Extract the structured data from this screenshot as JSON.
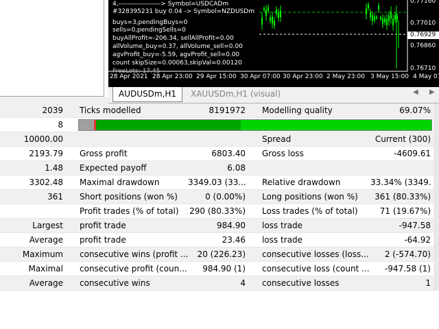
{
  "chart": {
    "overlay_lines": [
      "4,-------------------> Symbol=USDCADm",
      "#328395231 buy 0.04 -> Symbol=NZDUSDm",
      "buys=3,pendingBuys=0",
      "sells=0,pendingSells=0",
      "buyAllProfit=-206.34, sellAllProfit=0.00",
      "allVolume_buy=0.37, allVolume_sell=0.00",
      "agvProfit_buy=-5.59, agvProfit_sell=0.00",
      "count skipSize=0.00063,skipVal=0.00120",
      "FreeLots: 17.45"
    ],
    "prices": [
      "0.77160",
      "0.77010",
      "0.76929",
      "0.76860",
      "0.76710"
    ],
    "current_price": "0.76929",
    "dates": [
      "28 Apr 2021",
      "28 Apr 23:00",
      "29 Apr 15:00",
      "30 Apr 07:00",
      "30 Apr 23:00",
      "2 May 23:00",
      "3 May 15:00",
      "4 May 07:00"
    ]
  },
  "tabs": {
    "active": "AUDUSDm,H1",
    "inactive": "XAUUSDm,H1 (visual)",
    "left_arrow": "◀",
    "right_arrow": "▶"
  },
  "progress": {
    "ticks_fraction": 0.46,
    "quality_fraction": 0.5
  },
  "rows": [
    [
      "2039",
      "Ticks modelled",
      "8191972",
      "Modelling quality",
      "69.07%"
    ],
    [
      "8",
      "",
      "",
      "",
      ""
    ],
    [
      "10000.00",
      "",
      "",
      "Spread",
      "Current (300)"
    ],
    [
      "2193.79",
      "Gross profit",
      "6803.40",
      "Gross loss",
      "-4609.61"
    ],
    [
      "1.48",
      "Expected payoff",
      "6.08",
      "",
      ""
    ],
    [
      "3302.48",
      "Maximal drawdown",
      "3349.03 (33....",
      "Relative drawdown",
      "33.34% (3349...."
    ],
    [
      "361",
      "Short positions (won %)",
      "0 (0.00%)",
      "Long positions (won %)",
      "361 (80.33%)"
    ],
    [
      "",
      "Profit trades (% of total)",
      "290 (80.33%)",
      "Loss trades (% of total)",
      "71 (19.67%)"
    ],
    [
      "Largest",
      "profit trade",
      "984.90",
      "loss trade",
      "-947.58"
    ],
    [
      "Average",
      "profit trade",
      "23.46",
      "loss trade",
      "-64.92"
    ],
    [
      "Maximum",
      "consecutive wins (profit ...",
      "20 (226.23)",
      "consecutive losses (loss...",
      "2 (-574.70)"
    ],
    [
      "Maximal",
      "consecutive profit (coun...",
      "984.90 (1)",
      "consecutive loss (count ...",
      "-947.58 (1)"
    ],
    [
      "Average",
      "consecutive wins",
      "4",
      "consecutive losses",
      "1"
    ]
  ],
  "colors": {
    "chart_bg": "#000000",
    "candle_green": "#00ff00",
    "bar_dark_green": "#00a400",
    "bar_light_green": "#00d400",
    "row_alt": "#f0f0f0"
  }
}
